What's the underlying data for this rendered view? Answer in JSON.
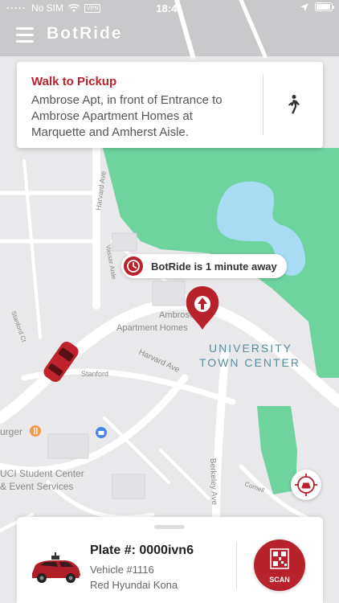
{
  "status_bar": {
    "signal": "·····",
    "carrier": "No SIM",
    "vpn": "VPN",
    "time": "18:41",
    "battery_level": 0.92,
    "icons": [
      "wifi-icon",
      "location-arrow-icon",
      "battery-icon"
    ]
  },
  "header": {
    "brand": "BotRide",
    "menu_icon": "hamburger-menu-icon"
  },
  "pickup_card": {
    "title": "Walk to Pickup",
    "address": "Ambrose Apt, in front of Entrance to Ambrose Apartment Homes at Marquette and Amherst Aisle.",
    "icon": "walking-person-icon"
  },
  "eta": {
    "text": "BotRide is 1 minute away",
    "icon": "clock-icon"
  },
  "map": {
    "labels": {
      "harvard_ave_n": "Harvard Ave",
      "harvard_ave_s": "Harvard Ave",
      "vassar": "Vassar Aisle",
      "stanford_ct": "Stanford Ct",
      "stanford": "Stanford",
      "ambrose_1": "Ambrose",
      "ambrose_2": "Apartment Homes",
      "utc_1": "UNIVERSITY",
      "utc_2": "TOWN CENTER",
      "burger": "urger",
      "student_center_1": "UCI Student Center",
      "student_center_2": "& Event Services",
      "berkeley": "Berkeley Ave",
      "cornell": "Cornell"
    },
    "colors": {
      "park": "#6fd3a0",
      "water": "#a7dcf2",
      "road": "#ffffff",
      "land": "#e9e9eb",
      "accent": "#b8222b"
    }
  },
  "recenter_icon": "car-target-icon",
  "vehicle": {
    "plate": "Plate #: 0000ivn6",
    "number": "Vehicle #1116",
    "model": "Red Hyundai Kona",
    "scan_label": "SCAN",
    "scan_icon": "qr-code-icon"
  }
}
